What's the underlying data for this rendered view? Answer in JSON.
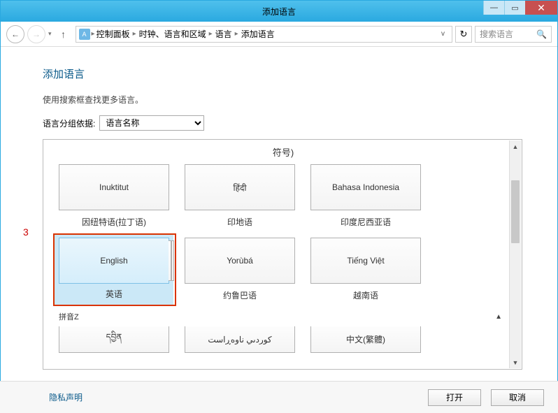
{
  "window": {
    "title": "添加语言"
  },
  "nav": {
    "breadcrumbs": [
      "控制面板",
      "时钟、语言和区域",
      "语言",
      "添加语言"
    ],
    "search_placeholder": "搜索语言"
  },
  "page": {
    "title": "添加语言",
    "hint": "使用搜索框查找更多语言。",
    "group_label": "语言分组依据:",
    "group_value": "语言名称"
  },
  "annotation": {
    "marker": "3"
  },
  "tiles": {
    "top_section_title": "符号)",
    "row1": [
      {
        "native": "Inuktitut",
        "label": "因纽特语(拉丁语)",
        "stack": false
      },
      {
        "native": "हिंदी",
        "label": "印地语",
        "stack": false
      },
      {
        "native": "Bahasa Indonesia",
        "label": "印度尼西亚语",
        "stack": false
      }
    ],
    "row2": [
      {
        "native": "English",
        "label": "英语",
        "stack": true,
        "selected": true
      },
      {
        "native": "Yorùbá",
        "label": "约鲁巴语",
        "stack": false
      },
      {
        "native": "Tiếng Việt",
        "label": "越南语",
        "stack": false
      }
    ],
    "section2_header": "拼音Z",
    "row3": [
      {
        "native": "དབྱིན",
        "label": "",
        "stack": true
      },
      {
        "native": "كوردىي ناوەڕاست",
        "label": "",
        "stack": true
      },
      {
        "native": "中文(繁體)",
        "label": "",
        "stack": true
      }
    ]
  },
  "footer": {
    "privacy": "隐私声明",
    "open": "打开",
    "cancel": "取消"
  }
}
